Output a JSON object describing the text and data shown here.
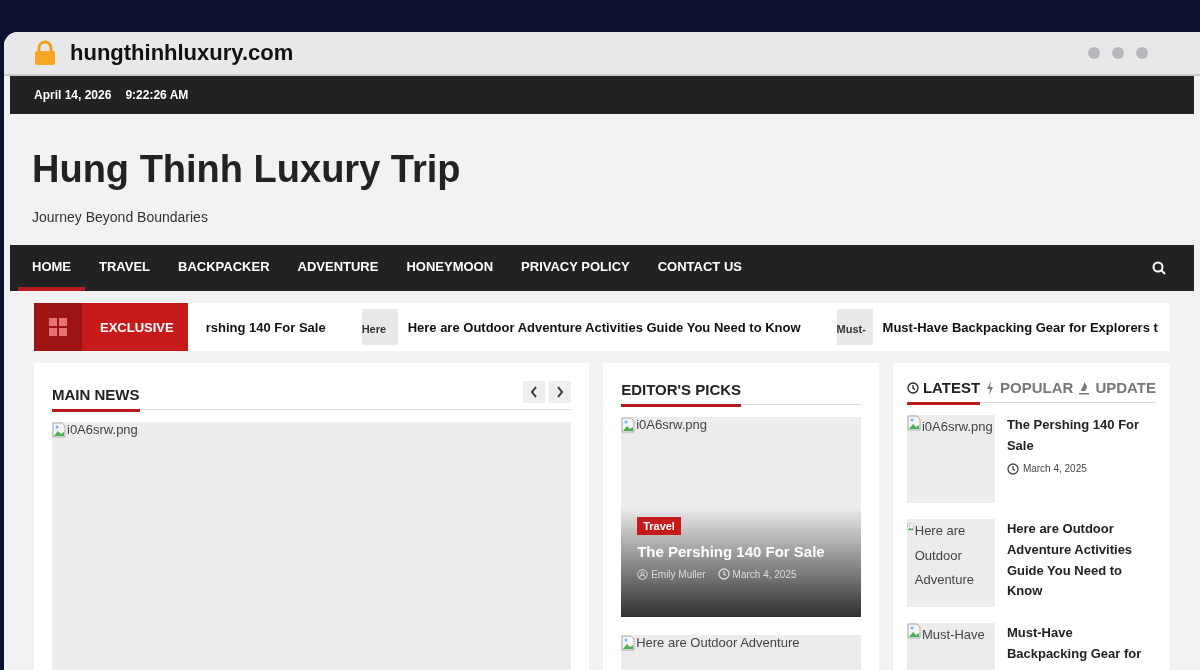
{
  "browser": {
    "url": "hungthinhluxury.com"
  },
  "top_bar": {
    "date": "April 14, 2026",
    "time": "9:22:26 AM"
  },
  "header": {
    "title": "Hung Thinh Luxury Trip",
    "tagline": "Journey Beyond Boundaries"
  },
  "nav": {
    "items": [
      {
        "label": "HOME",
        "selected": true
      },
      {
        "label": "TRAVEL",
        "selected": false
      },
      {
        "label": "BACKPACKER",
        "selected": false
      },
      {
        "label": "ADVENTURE",
        "selected": false
      },
      {
        "label": "HONEYMOON",
        "selected": false
      },
      {
        "label": "PRIVACY POLICY",
        "selected": false
      },
      {
        "label": "CONTACT US",
        "selected": false
      }
    ]
  },
  "ticker": {
    "label": "EXCLUSIVE",
    "items": [
      {
        "title": "rshing 140 For Sale"
      },
      {
        "thumb_alt": "Here",
        "title": "Here are Outdoor Adventure Activities Guide You Need to Know"
      },
      {
        "thumb_alt": "Must-",
        "title": "Must-Have Backpacking Gear for Explorers t"
      }
    ]
  },
  "main_news": {
    "heading": "MAIN NEWS",
    "image_alt": "i0A6srw.png"
  },
  "editors_picks": {
    "heading": "EDITOR'S PICKS",
    "featured": {
      "image_alt": "i0A6srw.png",
      "tag": "Travel",
      "title": "The Pershing 140 For Sale",
      "author": "Emily Muller",
      "date": "March 4, 2025"
    },
    "next": {
      "image_alt": "Here are Outdoor Adventure"
    }
  },
  "sidebar": {
    "tabs": [
      {
        "label": "LATEST",
        "selected": true
      },
      {
        "label": "POPULAR",
        "selected": false
      },
      {
        "label": "UPDATE",
        "selected": false
      }
    ],
    "posts": [
      {
        "image_alt": "i0A6srw.png",
        "title": "The Pershing 140 For Sale",
        "date": "March 4, 2025"
      },
      {
        "image_alt": "Here are Outdoor Adventure",
        "title": "Here are Outdoor Adventure Activities Guide You Need to Know"
      },
      {
        "image_alt": "Must-Have",
        "title": "Must-Have Backpacking Gear for"
      }
    ]
  }
}
